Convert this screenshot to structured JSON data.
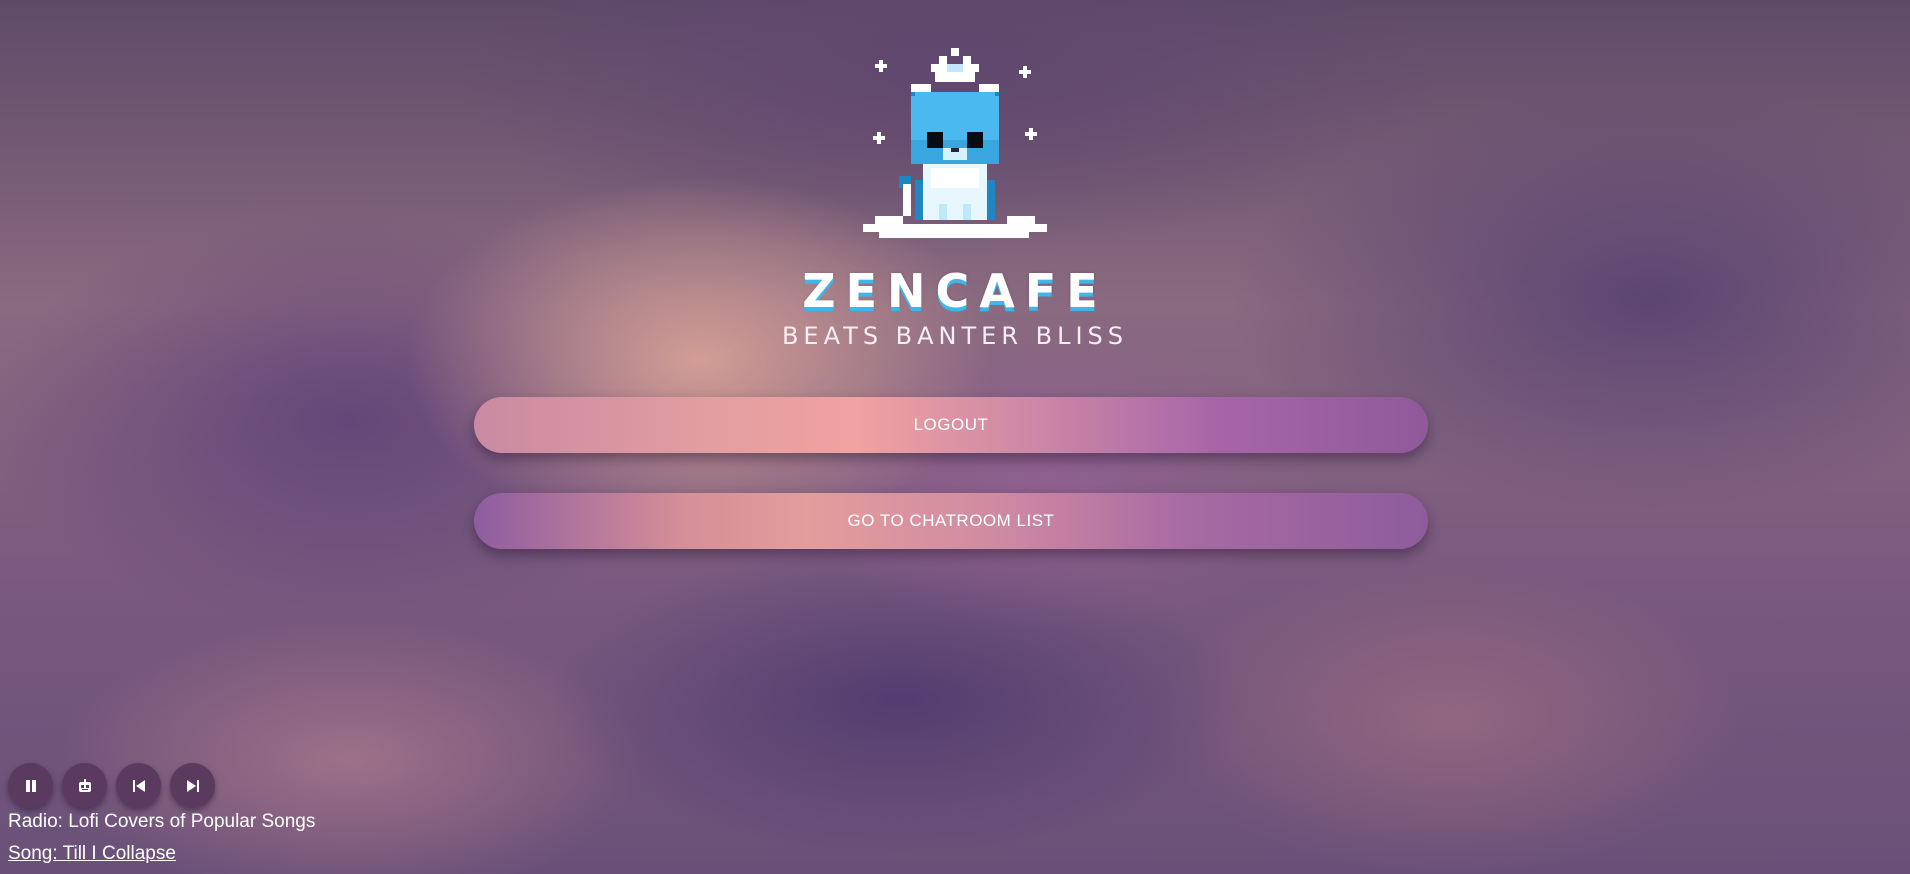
{
  "brand": {
    "logo_icon": "pixel-cat-with-crown",
    "wordmark": "ZENCAFE",
    "tagline": "BEATS BANTER BLISS"
  },
  "actions": {
    "logout_label": "LOGOUT",
    "chatroom_label": "GO TO CHATROOM LIST"
  },
  "player": {
    "controls": [
      {
        "name": "pause",
        "icon": "pause-icon"
      },
      {
        "name": "bot",
        "icon": "robot-icon"
      },
      {
        "name": "previous",
        "icon": "skip-previous-icon"
      },
      {
        "name": "next",
        "icon": "skip-next-icon"
      }
    ],
    "radio_text": "Radio: Lofi Covers of Popular Songs",
    "song_text": "Song: Till I Collapse"
  },
  "colors": {
    "accent_blue": "#3fb6ea",
    "player_button": "#5b3a5f"
  }
}
